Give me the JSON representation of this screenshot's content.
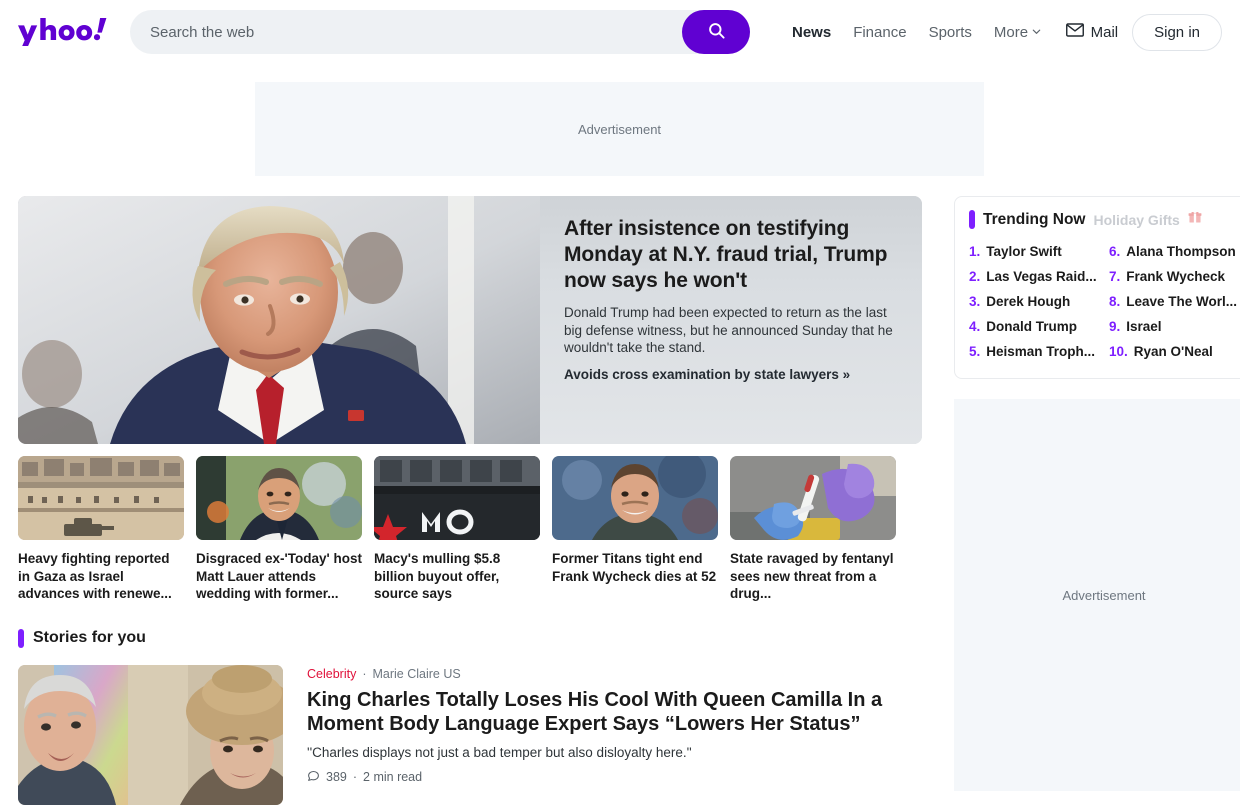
{
  "header": {
    "logo_text": "yahoo!",
    "search": {
      "placeholder": "Search the web",
      "value": "",
      "button_icon": "search-icon"
    },
    "nav": [
      {
        "label": "News",
        "active": true
      },
      {
        "label": "Finance",
        "active": false
      },
      {
        "label": "Sports",
        "active": false
      },
      {
        "label": "More",
        "active": false,
        "caret": "chevron-down-icon"
      }
    ],
    "mail_label": "Mail",
    "mail_icon": "envelope-icon",
    "signin_label": "Sign in"
  },
  "ads": {
    "top_label": "Advertisement",
    "side_label": "Advertisement"
  },
  "hero": {
    "title": "After insistence on testifying Monday at N.Y. fraud trial, Trump now says he won't",
    "summary": "Donald Trump had been expected to return as the last big defense witness, but he announced Sunday that he wouldn't take the stand.",
    "link": "Avoids cross examination by state lawyers »"
  },
  "thumbs": [
    {
      "caption": "Heavy fighting reported in Gaza as Israel advances with renewe..."
    },
    {
      "caption": "Disgraced ex-'Today' host Matt Lauer attends wedding with former..."
    },
    {
      "caption": "Macy's mulling $5.8 billion buyout offer, source says"
    },
    {
      "caption": "Former Titans tight end Frank Wycheck dies at 52"
    },
    {
      "caption": "State ravaged by fentanyl sees new threat from a drug..."
    }
  ],
  "stories_section": {
    "heading": "Stories for you",
    "items": [
      {
        "category": "Celebrity",
        "separator": "·",
        "source": "Marie Claire US",
        "title": "King Charles Totally Loses His Cool With Queen Camilla In a Moment Body Language Expert Says “Lowers Her Status”",
        "description": "''Charles displays not just a bad temper but also disloyalty here.''",
        "comments": "389",
        "stats_separator": "·",
        "read_time": "2 min read",
        "comment_icon": "comment-bubble-icon"
      }
    ]
  },
  "trending": {
    "title": "Trending Now",
    "subtitle": "Holiday Gifts",
    "gift_icon": "gift-icon",
    "items": [
      {
        "rank": "1.",
        "label": "Taylor Swift"
      },
      {
        "rank": "2.",
        "label": "Las Vegas Raid..."
      },
      {
        "rank": "3.",
        "label": "Derek Hough"
      },
      {
        "rank": "4.",
        "label": "Donald Trump"
      },
      {
        "rank": "5.",
        "label": "Heisman Troph..."
      },
      {
        "rank": "6.",
        "label": "Alana Thompson"
      },
      {
        "rank": "7.",
        "label": "Frank Wycheck"
      },
      {
        "rank": "8.",
        "label": "Leave The Worl..."
      },
      {
        "rank": "9.",
        "label": "Israel"
      },
      {
        "rank": "10.",
        "label": "Ryan O'Neal"
      }
    ]
  },
  "colors": {
    "brand_purple": "#6001d2",
    "accent_purple": "#7e1fff",
    "category_red": "#e0113a",
    "ad_background": "#f4f7fa"
  }
}
